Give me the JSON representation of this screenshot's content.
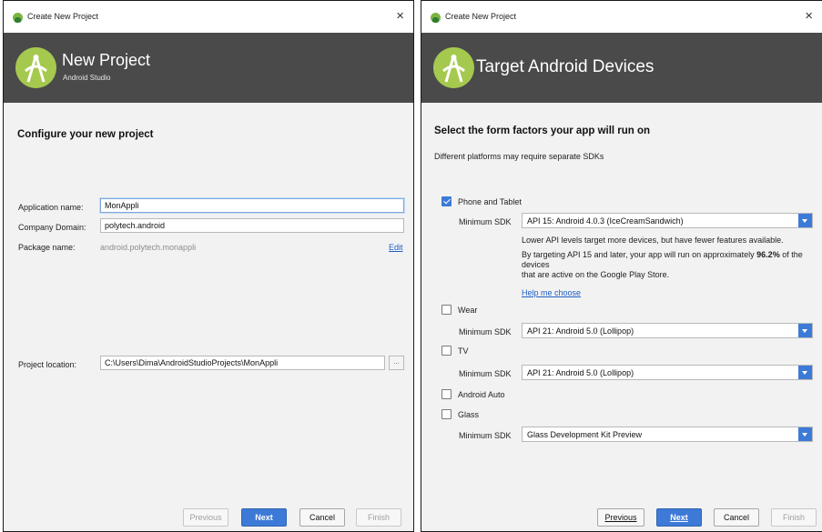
{
  "left_window": {
    "titlebar": {
      "title": "Create New Project",
      "close": "×"
    },
    "banner": {
      "title": "New Project",
      "subtitle": "Android Studio"
    },
    "heading": "Configure your new project",
    "form": {
      "app_name_label": "Application name:",
      "app_name_value": "MonAppli",
      "company_label": "Company Domain:",
      "company_value": "polytech.android",
      "package_label": "Package name:",
      "package_value": "android.polytech.monappli",
      "edit_link": "Edit",
      "location_label": "Project location:",
      "location_value": "C:\\Users\\Dima\\AndroidStudioProjects\\MonAppli",
      "browse": "..."
    },
    "buttons": {
      "previous": "Previous",
      "next": "Next",
      "cancel": "Cancel",
      "finish": "Finish"
    }
  },
  "right_window": {
    "titlebar": {
      "title": "Create New Project",
      "close": "×"
    },
    "banner": {
      "title": "Target Android Devices"
    },
    "heading": "Select the form factors your app will run on",
    "subheading": "Different platforms may require separate SDKs",
    "min_sdk_label": "Minimum SDK",
    "phone": {
      "label": "Phone and Tablet",
      "checked": true,
      "sdk": "API 15: Android 4.0.3 (IceCreamSandwich)",
      "info_line1": "Lower API levels target more devices, but have fewer features available.",
      "info_line2_pre": "By targeting API 15 and later, your app will run on approximately",
      "info_line2_pct": "96.2%",
      "info_line2_post": "of the",
      "info_line3": "devices",
      "info_line4": "that are active on the Google Play Store.",
      "help_link": "Help me choose"
    },
    "wear": {
      "label": "Wear",
      "checked": false,
      "sdk": "API 21: Android 5.0 (Lollipop)"
    },
    "tv": {
      "label": "TV",
      "checked": false,
      "sdk": "API 21: Android 5.0 (Lollipop)"
    },
    "auto": {
      "label": "Android Auto",
      "checked": false
    },
    "glass": {
      "label": "Glass",
      "checked": false,
      "sdk": "Glass Development Kit Preview"
    },
    "buttons": {
      "previous": "Previous",
      "next": "Next",
      "cancel": "Cancel",
      "finish": "Finish"
    }
  },
  "colors": {
    "accent": "#3d7ad8",
    "banner": "#4a4a4a",
    "link": "#1f5fc6",
    "logo": "#a5c94f"
  }
}
